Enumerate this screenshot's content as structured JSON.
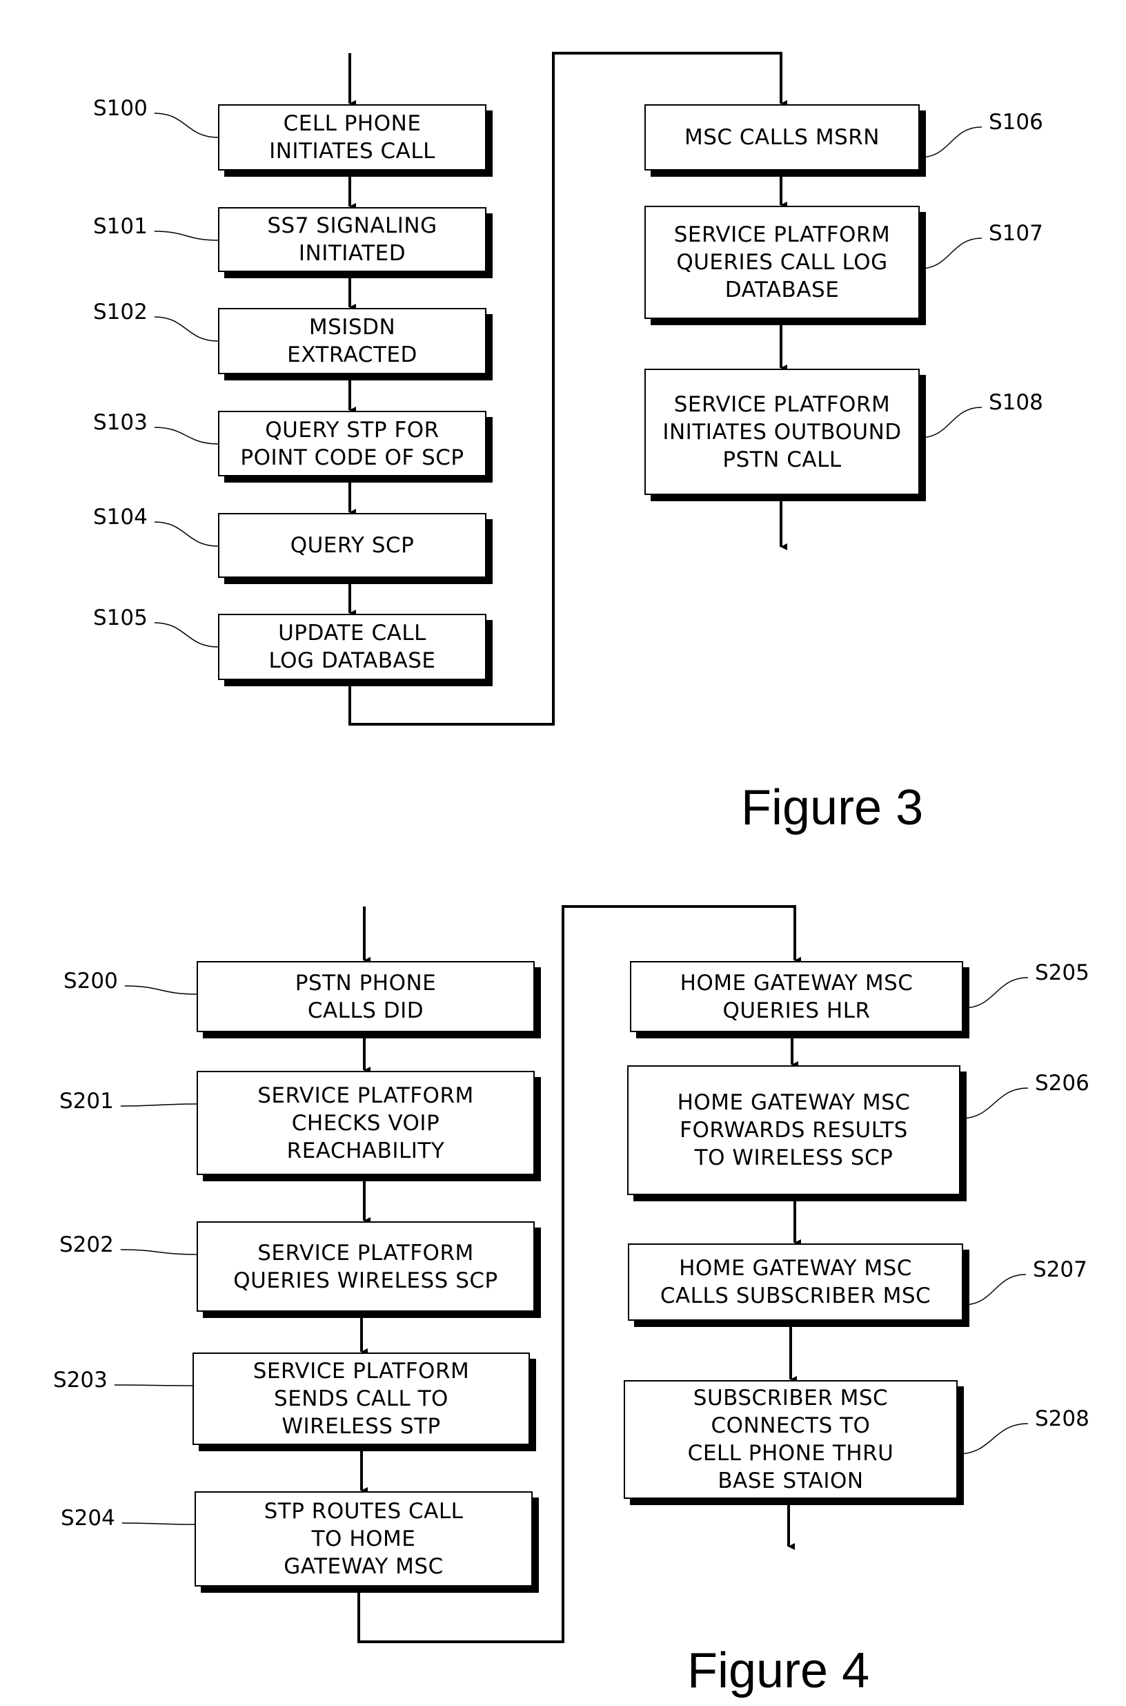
{
  "figure3": {
    "title": "Figure 3",
    "steps": [
      {
        "id": "S100",
        "text": "CELL PHONE\nINITIATES CALL"
      },
      {
        "id": "S101",
        "text": "SS7 SIGNALING\nINITIATED"
      },
      {
        "id": "S102",
        "text": "MSISDN\nEXTRACTED"
      },
      {
        "id": "S103",
        "text": "QUERY STP FOR\nPOINT CODE OF SCP"
      },
      {
        "id": "S104",
        "text": "QUERY SCP"
      },
      {
        "id": "S105",
        "text": "UPDATE CALL\nLOG DATABASE"
      },
      {
        "id": "S106",
        "text": "MSC CALLS MSRN"
      },
      {
        "id": "S107",
        "text": "SERVICE PLATFORM\nQUERIES CALL LOG\nDATABASE"
      },
      {
        "id": "S108",
        "text": "SERVICE PLATFORM\nINITIATES OUTBOUND\nPSTN CALL"
      }
    ]
  },
  "figure4": {
    "title": "Figure 4",
    "steps": [
      {
        "id": "S200",
        "text": "PSTN PHONE\nCALLS DID"
      },
      {
        "id": "S201",
        "text": "SERVICE PLATFORM\nCHECKS VOIP\nREACHABILITY"
      },
      {
        "id": "S202",
        "text": "SERVICE  PLATFORM\nQUERIES WIRELESS SCP"
      },
      {
        "id": "S203",
        "text": "SERVICE  PLATFORM\nSENDS CALL TO\nWIRELESS STP"
      },
      {
        "id": "S204",
        "text": "STP ROUTES CALL\nTO HOME\nGATEWAY MSC"
      },
      {
        "id": "S205",
        "text": "HOME GATEWAY MSC\nQUERIES HLR"
      },
      {
        "id": "S206",
        "text": "HOME GATEWAY MSC\nFORWARDS RESULTS\nTO WIRELESS SCP"
      },
      {
        "id": "S207",
        "text": "HOME GATEWAY MSC\nCALLS SUBSCRIBER MSC"
      },
      {
        "id": "S208",
        "text": "SUBSCRIBER MSC\nCONNECTS TO\nCELL PHONE THRU\nBASE STAION"
      }
    ]
  }
}
